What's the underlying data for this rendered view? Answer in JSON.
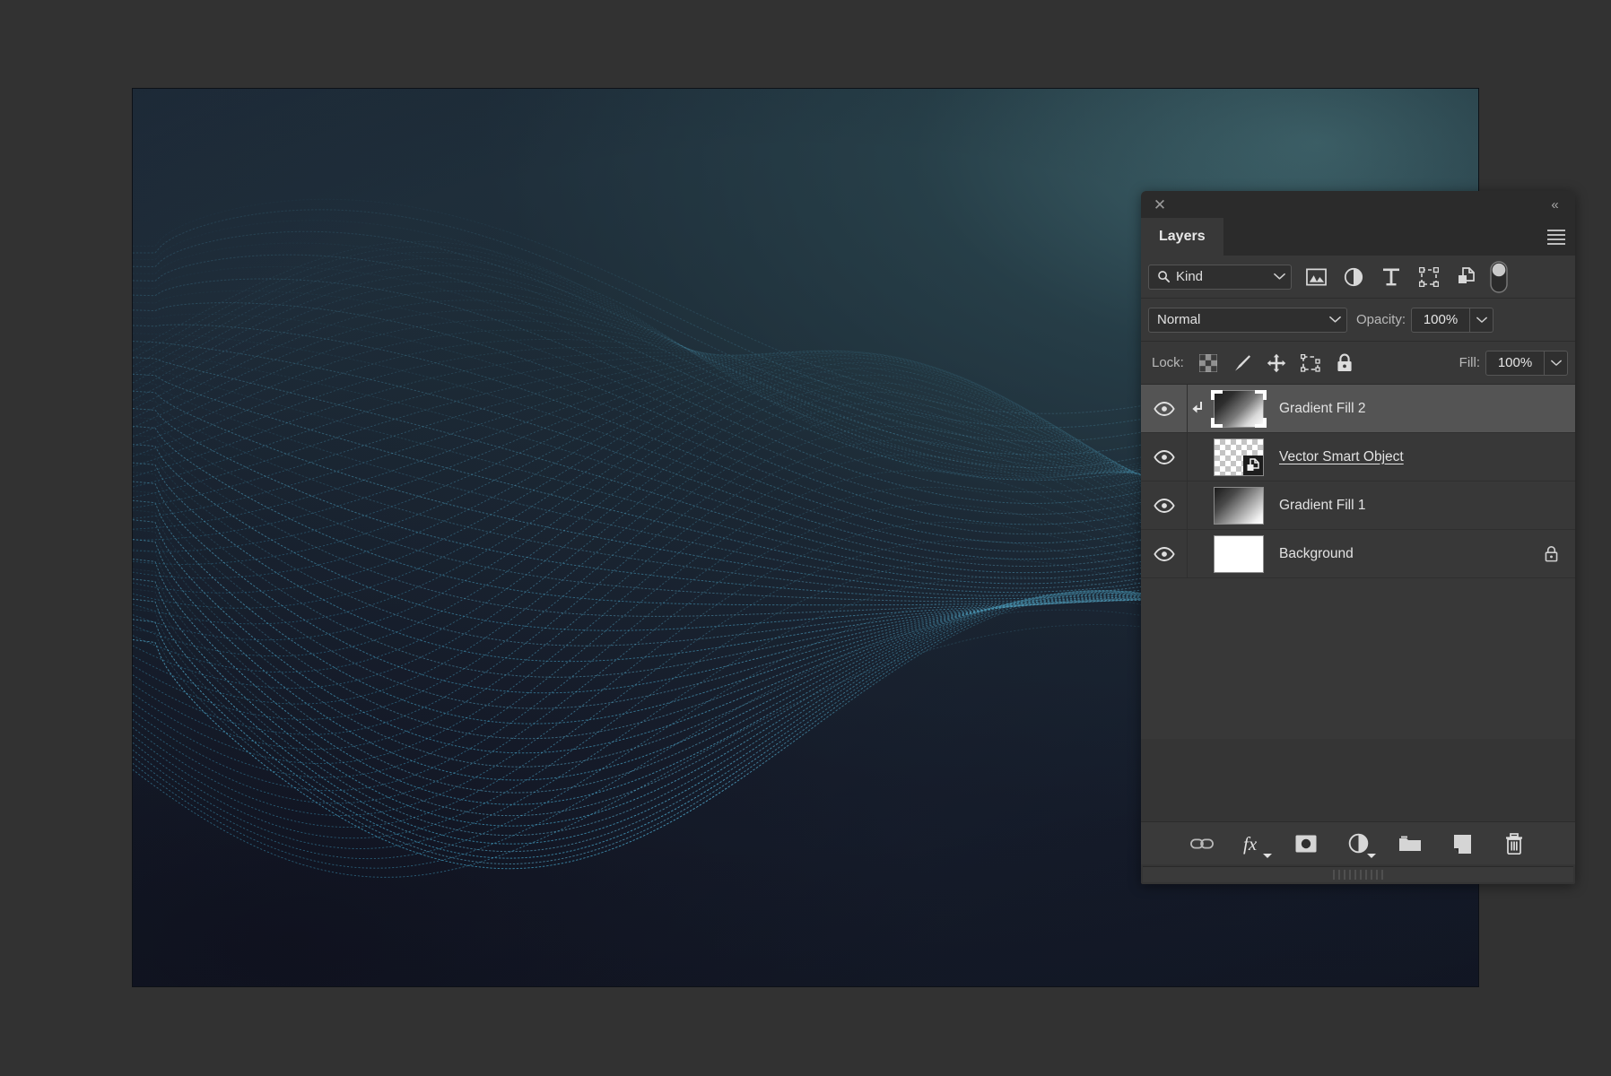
{
  "app": {
    "background_color": "#323232"
  },
  "document": {
    "canvas_name": "untitled-artwork-canvas",
    "artwork_description": "Dark teal gradient with flowing dotted wave mesh",
    "colors": {
      "gradient_top_right": "#3f6670",
      "gradient_bottom_left": "#11152a",
      "wave_line": "#5fb3d4",
      "wave_line_dim": "#2d5f72"
    }
  },
  "panel": {
    "titlebar": {
      "close_label": "✕",
      "collapse_label": "«"
    },
    "tab_label": "Layers",
    "menu_icon": "hamburger-menu-icon",
    "filter": {
      "search_icon": "search-icon",
      "kind_label": "Kind",
      "kind_chevron": "⌄",
      "icons": [
        {
          "name": "filter-pixel-layers-icon",
          "title": "Filter for pixel layers"
        },
        {
          "name": "filter-adjustment-layers-icon",
          "title": "Filter for adjustment layers"
        },
        {
          "name": "filter-type-layers-icon",
          "title": "Filter for type layers"
        },
        {
          "name": "filter-shape-layers-icon",
          "title": "Filter for shape layers"
        },
        {
          "name": "filter-smart-object-layers-icon",
          "title": "Filter for smart objects"
        }
      ],
      "toggle_name": "filter-enable-toggle",
      "toggle_state": "off"
    },
    "blend": {
      "mode": "Normal",
      "mode_chevron": "⌄",
      "opacity_label": "Opacity:",
      "opacity_value": "100%",
      "opacity_chevron": "⌄"
    },
    "lock": {
      "label": "Lock:",
      "icons": [
        {
          "name": "lock-transparent-pixels-icon"
        },
        {
          "name": "lock-image-pixels-icon"
        },
        {
          "name": "lock-position-icon"
        },
        {
          "name": "lock-artboard-nesting-icon"
        },
        {
          "name": "lock-all-icon"
        }
      ],
      "fill_label": "Fill:",
      "fill_value": "100%",
      "fill_chevron": "⌄"
    },
    "layers": [
      {
        "name": "Gradient Fill 2",
        "selected": true,
        "visible": true,
        "clipped": true,
        "thumb_type": "gradient",
        "locked": false,
        "underlined": false
      },
      {
        "name": "Vector Smart Object",
        "selected": false,
        "visible": true,
        "clipped": false,
        "thumb_type": "smart-object",
        "locked": false,
        "underlined": true
      },
      {
        "name": "Gradient Fill 1",
        "selected": false,
        "visible": true,
        "clipped": false,
        "thumb_type": "gradient",
        "locked": false,
        "underlined": false
      },
      {
        "name": "Background",
        "selected": false,
        "visible": true,
        "clipped": false,
        "thumb_type": "white",
        "locked": true,
        "underlined": false
      }
    ],
    "footer_buttons": [
      {
        "name": "link-layers-button",
        "icon": "link-icon"
      },
      {
        "name": "layer-style-button",
        "icon": "fx-icon",
        "label": "fx"
      },
      {
        "name": "add-layer-mask-button",
        "icon": "mask-icon"
      },
      {
        "name": "new-adjustment-layer-button",
        "icon": "adjustment-circle-icon"
      },
      {
        "name": "new-group-button",
        "icon": "folder-icon"
      },
      {
        "name": "new-layer-button",
        "icon": "new-page-icon"
      },
      {
        "name": "delete-layer-button",
        "icon": "trash-icon"
      }
    ]
  }
}
